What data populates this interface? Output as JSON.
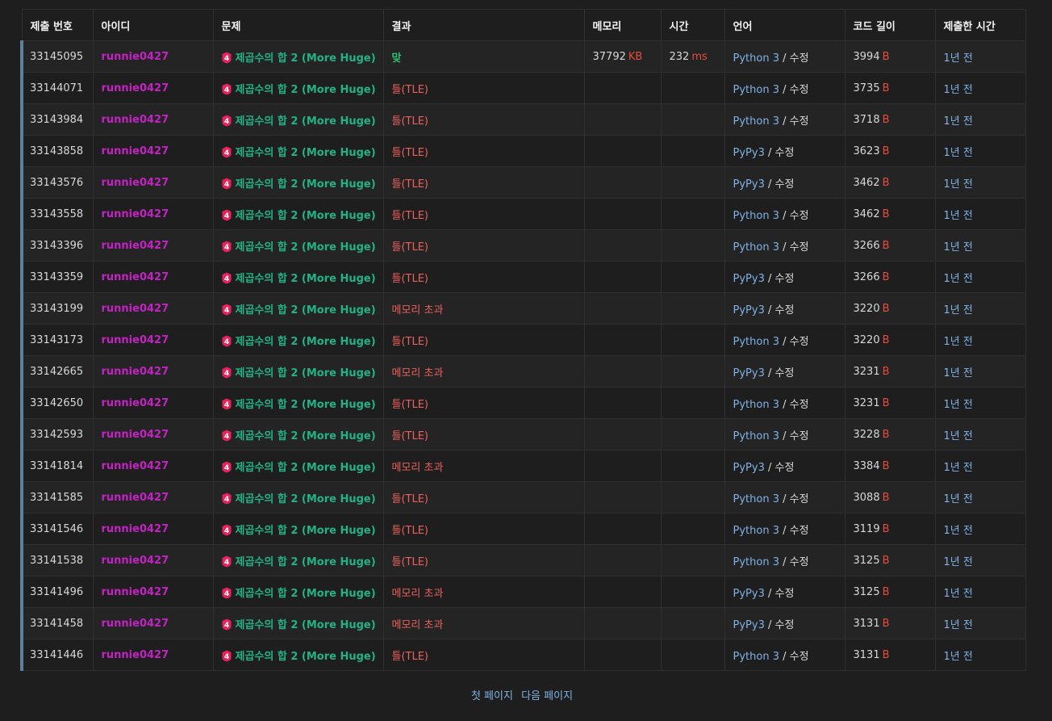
{
  "headers": [
    "제출 번호",
    "아이디",
    "문제",
    "결과",
    "메모리",
    "시간",
    "언어",
    "코드 길이",
    "제출한 시간"
  ],
  "problem_tier_label": "4",
  "colors": {
    "user": "#c223c2",
    "problem": "#23b285",
    "accepted": "#2ec16b",
    "wrong": "#e9605c",
    "unit": "#e74c3c",
    "link": "#7fb2e6",
    "tier_badge": "#e8225a"
  },
  "rows": [
    {
      "id": "33145095",
      "user": "runnie0427",
      "problem": "제곱수의 합 2 (More Huge)",
      "result": "맞",
      "result_type": "ac",
      "memory": "37792",
      "memory_unit": "KB",
      "time": "232",
      "time_unit": "ms",
      "lang": "Python 3",
      "edit": "수정",
      "length": "3994",
      "length_unit": "B",
      "ago": "1년 전"
    },
    {
      "id": "33144071",
      "user": "runnie0427",
      "problem": "제곱수의 합 2 (More Huge)",
      "result": "틀(TLE)",
      "result_type": "wa",
      "memory": "",
      "memory_unit": "",
      "time": "",
      "time_unit": "",
      "lang": "Python 3",
      "edit": "수정",
      "length": "3735",
      "length_unit": "B",
      "ago": "1년 전"
    },
    {
      "id": "33143984",
      "user": "runnie0427",
      "problem": "제곱수의 합 2 (More Huge)",
      "result": "틀(TLE)",
      "result_type": "wa",
      "memory": "",
      "memory_unit": "",
      "time": "",
      "time_unit": "",
      "lang": "Python 3",
      "edit": "수정",
      "length": "3718",
      "length_unit": "B",
      "ago": "1년 전"
    },
    {
      "id": "33143858",
      "user": "runnie0427",
      "problem": "제곱수의 합 2 (More Huge)",
      "result": "틀(TLE)",
      "result_type": "wa",
      "memory": "",
      "memory_unit": "",
      "time": "",
      "time_unit": "",
      "lang": "PyPy3",
      "edit": "수정",
      "length": "3623",
      "length_unit": "B",
      "ago": "1년 전"
    },
    {
      "id": "33143576",
      "user": "runnie0427",
      "problem": "제곱수의 합 2 (More Huge)",
      "result": "틀(TLE)",
      "result_type": "wa",
      "memory": "",
      "memory_unit": "",
      "time": "",
      "time_unit": "",
      "lang": "PyPy3",
      "edit": "수정",
      "length": "3462",
      "length_unit": "B",
      "ago": "1년 전"
    },
    {
      "id": "33143558",
      "user": "runnie0427",
      "problem": "제곱수의 합 2 (More Huge)",
      "result": "틀(TLE)",
      "result_type": "wa",
      "memory": "",
      "memory_unit": "",
      "time": "",
      "time_unit": "",
      "lang": "Python 3",
      "edit": "수정",
      "length": "3462",
      "length_unit": "B",
      "ago": "1년 전"
    },
    {
      "id": "33143396",
      "user": "runnie0427",
      "problem": "제곱수의 합 2 (More Huge)",
      "result": "틀(TLE)",
      "result_type": "wa",
      "memory": "",
      "memory_unit": "",
      "time": "",
      "time_unit": "",
      "lang": "Python 3",
      "edit": "수정",
      "length": "3266",
      "length_unit": "B",
      "ago": "1년 전"
    },
    {
      "id": "33143359",
      "user": "runnie0427",
      "problem": "제곱수의 합 2 (More Huge)",
      "result": "틀(TLE)",
      "result_type": "wa",
      "memory": "",
      "memory_unit": "",
      "time": "",
      "time_unit": "",
      "lang": "PyPy3",
      "edit": "수정",
      "length": "3266",
      "length_unit": "B",
      "ago": "1년 전"
    },
    {
      "id": "33143199",
      "user": "runnie0427",
      "problem": "제곱수의 합 2 (More Huge)",
      "result": "메모리 초과",
      "result_type": "wa",
      "memory": "",
      "memory_unit": "",
      "time": "",
      "time_unit": "",
      "lang": "PyPy3",
      "edit": "수정",
      "length": "3220",
      "length_unit": "B",
      "ago": "1년 전"
    },
    {
      "id": "33143173",
      "user": "runnie0427",
      "problem": "제곱수의 합 2 (More Huge)",
      "result": "틀(TLE)",
      "result_type": "wa",
      "memory": "",
      "memory_unit": "",
      "time": "",
      "time_unit": "",
      "lang": "Python 3",
      "edit": "수정",
      "length": "3220",
      "length_unit": "B",
      "ago": "1년 전"
    },
    {
      "id": "33142665",
      "user": "runnie0427",
      "problem": "제곱수의 합 2 (More Huge)",
      "result": "메모리 초과",
      "result_type": "wa",
      "memory": "",
      "memory_unit": "",
      "time": "",
      "time_unit": "",
      "lang": "PyPy3",
      "edit": "수정",
      "length": "3231",
      "length_unit": "B",
      "ago": "1년 전"
    },
    {
      "id": "33142650",
      "user": "runnie0427",
      "problem": "제곱수의 합 2 (More Huge)",
      "result": "틀(TLE)",
      "result_type": "wa",
      "memory": "",
      "memory_unit": "",
      "time": "",
      "time_unit": "",
      "lang": "Python 3",
      "edit": "수정",
      "length": "3231",
      "length_unit": "B",
      "ago": "1년 전"
    },
    {
      "id": "33142593",
      "user": "runnie0427",
      "problem": "제곱수의 합 2 (More Huge)",
      "result": "틀(TLE)",
      "result_type": "wa",
      "memory": "",
      "memory_unit": "",
      "time": "",
      "time_unit": "",
      "lang": "Python 3",
      "edit": "수정",
      "length": "3228",
      "length_unit": "B",
      "ago": "1년 전"
    },
    {
      "id": "33141814",
      "user": "runnie0427",
      "problem": "제곱수의 합 2 (More Huge)",
      "result": "메모리 초과",
      "result_type": "wa",
      "memory": "",
      "memory_unit": "",
      "time": "",
      "time_unit": "",
      "lang": "PyPy3",
      "edit": "수정",
      "length": "3384",
      "length_unit": "B",
      "ago": "1년 전"
    },
    {
      "id": "33141585",
      "user": "runnie0427",
      "problem": "제곱수의 합 2 (More Huge)",
      "result": "틀(TLE)",
      "result_type": "wa",
      "memory": "",
      "memory_unit": "",
      "time": "",
      "time_unit": "",
      "lang": "Python 3",
      "edit": "수정",
      "length": "3088",
      "length_unit": "B",
      "ago": "1년 전"
    },
    {
      "id": "33141546",
      "user": "runnie0427",
      "problem": "제곱수의 합 2 (More Huge)",
      "result": "틀(TLE)",
      "result_type": "wa",
      "memory": "",
      "memory_unit": "",
      "time": "",
      "time_unit": "",
      "lang": "Python 3",
      "edit": "수정",
      "length": "3119",
      "length_unit": "B",
      "ago": "1년 전"
    },
    {
      "id": "33141538",
      "user": "runnie0427",
      "problem": "제곱수의 합 2 (More Huge)",
      "result": "틀(TLE)",
      "result_type": "wa",
      "memory": "",
      "memory_unit": "",
      "time": "",
      "time_unit": "",
      "lang": "Python 3",
      "edit": "수정",
      "length": "3125",
      "length_unit": "B",
      "ago": "1년 전"
    },
    {
      "id": "33141496",
      "user": "runnie0427",
      "problem": "제곱수의 합 2 (More Huge)",
      "result": "메모리 초과",
      "result_type": "wa",
      "memory": "",
      "memory_unit": "",
      "time": "",
      "time_unit": "",
      "lang": "PyPy3",
      "edit": "수정",
      "length": "3125",
      "length_unit": "B",
      "ago": "1년 전"
    },
    {
      "id": "33141458",
      "user": "runnie0427",
      "problem": "제곱수의 합 2 (More Huge)",
      "result": "메모리 초과",
      "result_type": "wa",
      "memory": "",
      "memory_unit": "",
      "time": "",
      "time_unit": "",
      "lang": "PyPy3",
      "edit": "수정",
      "length": "3131",
      "length_unit": "B",
      "ago": "1년 전"
    },
    {
      "id": "33141446",
      "user": "runnie0427",
      "problem": "제곱수의 합 2 (More Huge)",
      "result": "틀(TLE)",
      "result_type": "wa",
      "memory": "",
      "memory_unit": "",
      "time": "",
      "time_unit": "",
      "lang": "Python 3",
      "edit": "수정",
      "length": "3131",
      "length_unit": "B",
      "ago": "1년 전"
    }
  ],
  "pager": {
    "first": "첫 페이지",
    "next": "다음 페이지"
  }
}
